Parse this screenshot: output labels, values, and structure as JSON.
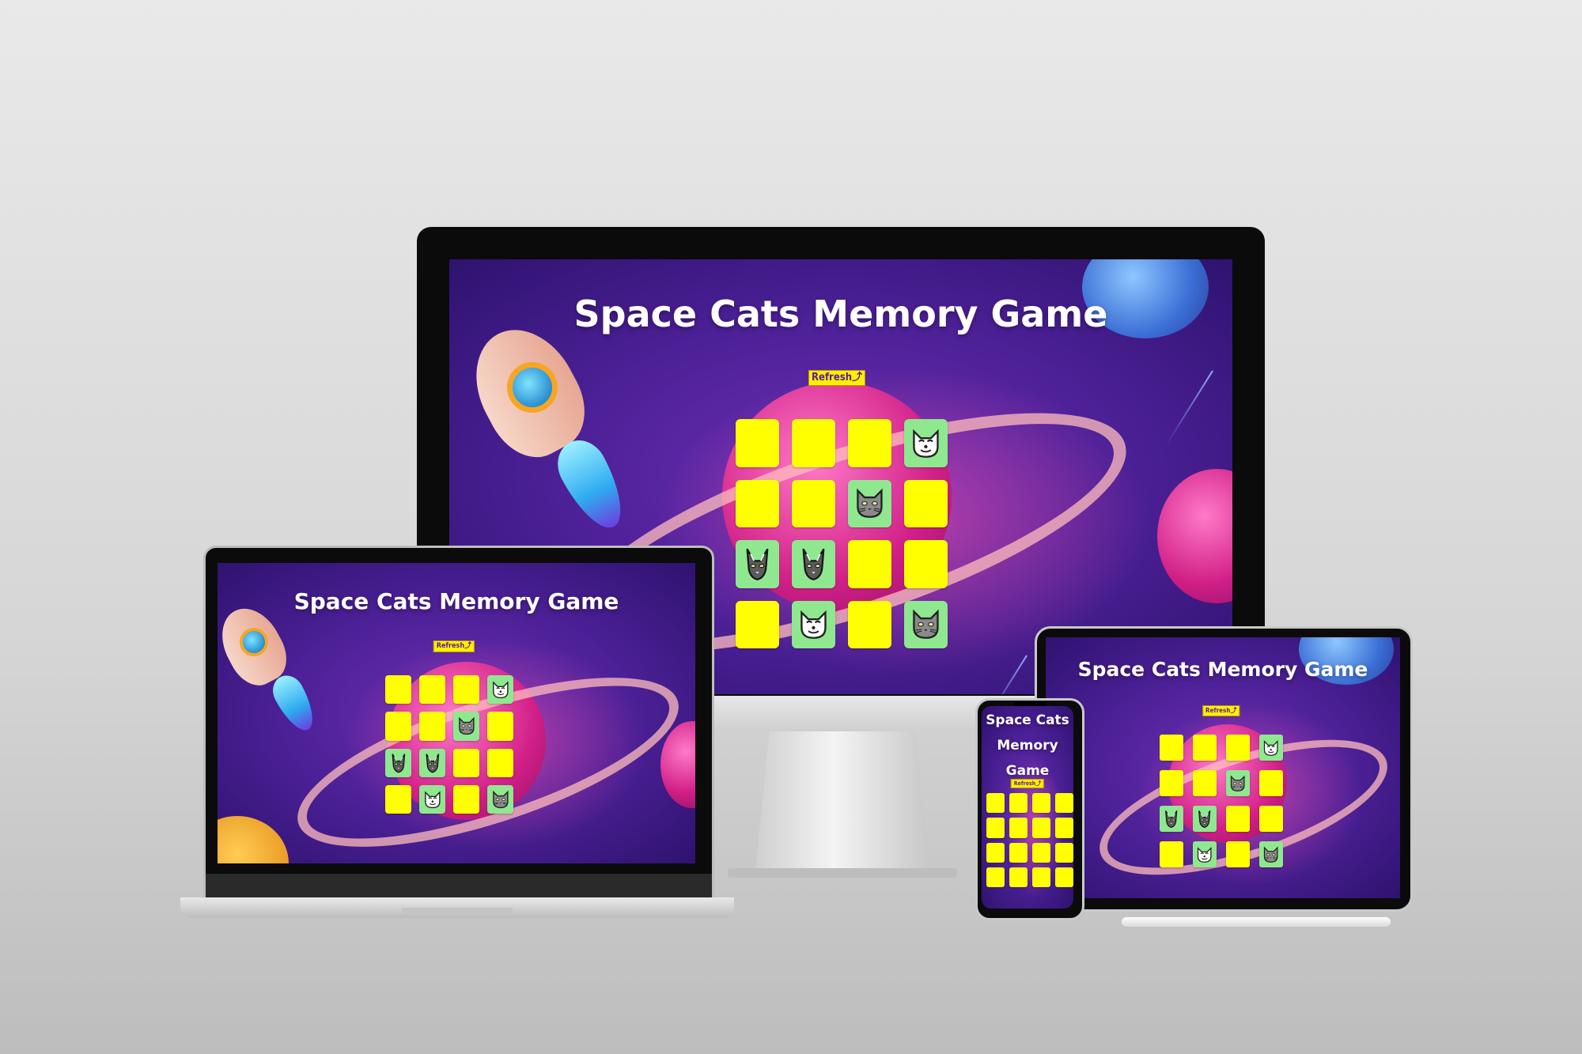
{
  "game": {
    "title": "Space Cats Memory Game",
    "title_phone": [
      "Space Cats",
      "Memory",
      "Game"
    ],
    "refresh_label": "Refresh⤴"
  },
  "board_desktop": [
    [
      "hidden",
      "hidden",
      "hidden",
      "cat-white"
    ],
    [
      "hidden",
      "hidden",
      "cat-gray",
      "hidden"
    ],
    [
      "cat-sphynx",
      "cat-sphynx",
      "hidden",
      "hidden"
    ],
    [
      "hidden",
      "cat-white",
      "hidden",
      "cat-gray"
    ]
  ],
  "board_phone": [
    [
      "hidden",
      "hidden",
      "hidden",
      "hidden"
    ],
    [
      "hidden",
      "hidden",
      "hidden",
      "hidden"
    ],
    [
      "hidden",
      "hidden",
      "hidden",
      "hidden"
    ],
    [
      "hidden",
      "hidden",
      "hidden",
      "hidden"
    ]
  ],
  "colors": {
    "card_hidden": "#ffff00",
    "card_flipped": "#8fe88f",
    "button_bg": "#ffef00",
    "button_text": "#5a1e9a",
    "title_text": "#ffffff"
  },
  "icons": {
    "cat-white": "white-cat-face-icon",
    "cat-gray": "gray-cat-face-icon",
    "cat-sphynx": "sphynx-cat-icon"
  }
}
